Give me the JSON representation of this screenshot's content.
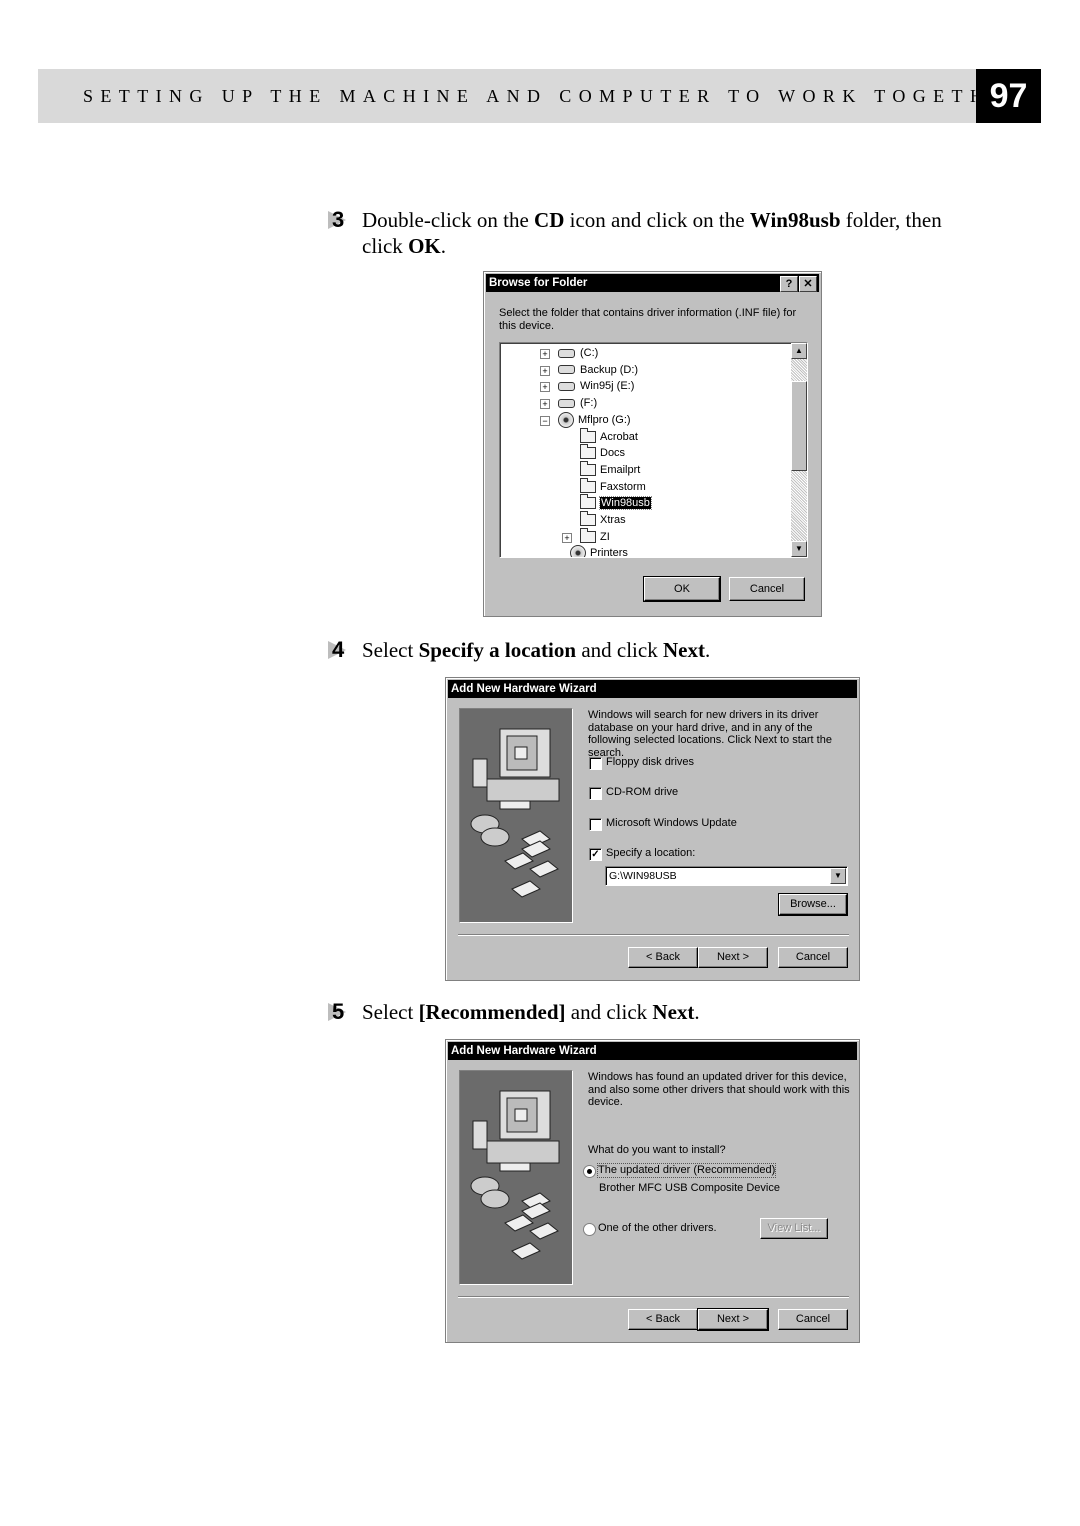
{
  "header": {
    "section_title": "SETTING UP THE  MACHINE AND COMPUTER TO WORK TOGETHER",
    "page_number": "97"
  },
  "steps": [
    {
      "number": "3",
      "parts": [
        "Double-click on the ",
        "CD",
        " icon and click on the ",
        "Win98usb",
        " folder, then click ",
        "OK",
        "."
      ]
    },
    {
      "number": "4",
      "parts": [
        "Select ",
        "Specify a location",
        " and click ",
        "Next",
        "."
      ]
    },
    {
      "number": "5",
      "parts": [
        "Select ",
        "[Recommended]",
        " and click ",
        "Next",
        "."
      ]
    }
  ],
  "browse_dialog": {
    "title": "Browse for Folder",
    "help_button": "?",
    "close_button": "✕",
    "instruction": "Select the folder that contains driver information (.INF file) for this device.",
    "tree_items": [
      {
        "label": "(C:)",
        "type": "drive",
        "expander": "+",
        "selected": false
      },
      {
        "label": "Backup (D:)",
        "type": "drive",
        "expander": "+",
        "selected": false
      },
      {
        "label": "Win95j (E:)",
        "type": "drive",
        "expander": "+",
        "selected": false
      },
      {
        "label": "(F:)",
        "type": "drive",
        "expander": "+",
        "selected": false
      },
      {
        "label": "Mflpro (G:)",
        "type": "cd-drive",
        "expander": "−",
        "selected": false
      },
      {
        "label": "Acrobat",
        "type": "folder",
        "expander": "",
        "selected": false
      },
      {
        "label": "Docs",
        "type": "folder",
        "expander": "",
        "selected": false
      },
      {
        "label": "Emailprt",
        "type": "folder",
        "expander": "",
        "selected": false
      },
      {
        "label": "Faxstorm",
        "type": "folder",
        "expander": "",
        "selected": false
      },
      {
        "label": "Win98usb",
        "type": "folder-open",
        "expander": "",
        "selected": true
      },
      {
        "label": "Xtras",
        "type": "folder",
        "expander": "",
        "selected": false
      },
      {
        "label": "ZI",
        "type": "folder",
        "expander": "+",
        "selected": false
      },
      {
        "label": "Printers",
        "type": "printers",
        "expander": "",
        "selected": false
      }
    ],
    "ok_label": "OK",
    "cancel_label": "Cancel"
  },
  "wizard_location": {
    "title": "Add New Hardware Wizard",
    "description": "Windows will search for new drivers in its driver database on your hard drive, and in any of the following selected locations. Click Next to start the search.",
    "options": [
      {
        "label": "Floppy disk drives",
        "accel": "F",
        "checked": false
      },
      {
        "label": "CD-ROM drive",
        "accel": "C",
        "checked": false
      },
      {
        "label": "Microsoft Windows Update",
        "accel": "M",
        "checked": false
      },
      {
        "label": "Specify a location:",
        "accel": "l",
        "checked": true
      }
    ],
    "location_value": "G:\\WIN98USB",
    "browse_label": "Browse...",
    "back_label": "< Back",
    "next_label": "Next >",
    "cancel_label": "Cancel"
  },
  "wizard_recommended": {
    "title": "Add New Hardware Wizard",
    "description": "Windows has found an updated driver for this device, and also some other drivers that should work with this device.",
    "question": "What do you want to install?",
    "options": [
      {
        "label": "The updated driver (Recommended)",
        "sublabel": "Brother MFC USB Composite Device",
        "selected": true
      },
      {
        "label": "One of the other drivers.",
        "selected": false
      }
    ],
    "view_list_label": "View List...",
    "back_label": "< Back",
    "next_label": "Next >",
    "cancel_label": "Cancel"
  }
}
